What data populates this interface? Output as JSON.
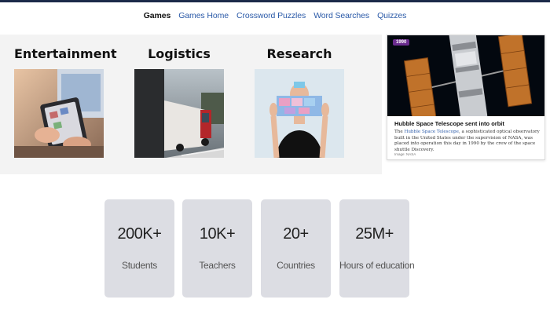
{
  "nav": {
    "items": [
      {
        "label": "Games",
        "active": true
      },
      {
        "label": "Games Home"
      },
      {
        "label": "Crossword Puzzles"
      },
      {
        "label": "Word Searches"
      },
      {
        "label": "Quizzes"
      }
    ]
  },
  "categories": [
    {
      "title": "Entertainment"
    },
    {
      "title": "Logistics"
    },
    {
      "title": "Research"
    }
  ],
  "feature": {
    "badge": "1990",
    "title": "Hubble Space Telescope sent into orbit",
    "text_before": "The ",
    "link": "Hubble Space Telescope",
    "text_after": ", a sophisticated optical observatory built in the United States under the supervision of NASA, was placed into operation this day in 1990 by the crew of the space shuttle Discovery.",
    "credit": "Image: NASA",
    "accent": "#6b2c8f"
  },
  "stats": [
    {
      "value": "200K+",
      "label": "Students"
    },
    {
      "value": "10K+",
      "label": "Teachers"
    },
    {
      "value": "20+",
      "label": "Countries"
    },
    {
      "value": "25M+",
      "label": "Hours of education"
    }
  ],
  "colors": {
    "nav_link": "#2b5aa8",
    "band_bg": "#f3f3f3",
    "stat_bg": "#dcdde3",
    "topbar": "#1b2a49"
  }
}
